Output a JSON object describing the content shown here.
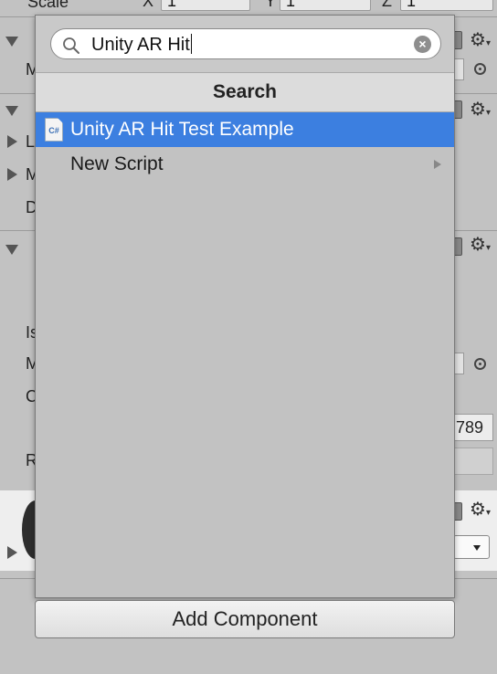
{
  "inspector": {
    "scale_label": "Scale",
    "scale_x_label": "X",
    "scale_x_value": "1",
    "scale_y_label": "Y",
    "scale_y_value": "1",
    "scale_z_label": "Z",
    "scale_z_value": "1",
    "clipped_labels": [
      "M",
      "L",
      "M",
      "D",
      "Is",
      "M",
      "C",
      "R"
    ],
    "partial_value": "789"
  },
  "popup": {
    "search": {
      "value": "Unity AR Hit",
      "placeholder": ""
    },
    "header": "Search",
    "items": [
      {
        "label": "Unity AR Hit Test Example",
        "icon": "csharp-script-icon",
        "icon_text": "C#",
        "selected": true
      },
      {
        "label": "New Script",
        "has_submenu": true,
        "selected": false
      }
    ]
  },
  "add_component_label": "Add Component",
  "colors": {
    "selection": "#3c7fe0",
    "panel": "#c2c2c2"
  }
}
